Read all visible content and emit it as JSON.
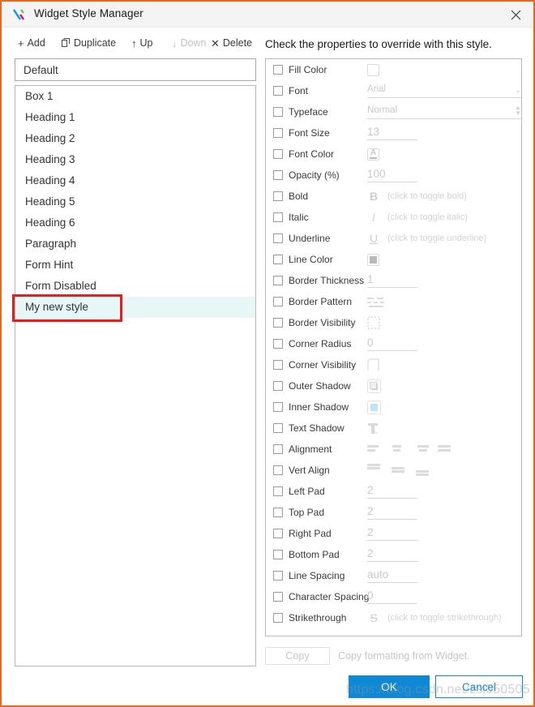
{
  "window": {
    "title": "Widget Style Manager",
    "logo_icon": "x-logo-icon",
    "close_icon": "close-icon",
    "accent_border": "#e8691c"
  },
  "toolbar": {
    "add": {
      "label": "Add",
      "glyph": "+",
      "icon": "plus-icon",
      "disabled": false
    },
    "duplicate": {
      "label": "Duplicate",
      "glyph": "❐",
      "icon": "duplicate-icon",
      "disabled": false
    },
    "up": {
      "label": "Up",
      "glyph": "↑",
      "icon": "arrow-up-icon",
      "disabled": false
    },
    "down": {
      "label": "Down",
      "glyph": "↓",
      "icon": "arrow-down-icon",
      "disabled": true
    },
    "delete": {
      "label": "Delete",
      "glyph": "✕",
      "icon": "close-x-icon",
      "disabled": false
    }
  },
  "panel_caption": "Check the properties to override with this style.",
  "style_name_field": {
    "value": "Default",
    "placeholder": "Default"
  },
  "style_list": {
    "items": [
      {
        "label": "Box 1",
        "selected": false
      },
      {
        "label": "Heading 1",
        "selected": false
      },
      {
        "label": "Heading 2",
        "selected": false
      },
      {
        "label": "Heading 3",
        "selected": false
      },
      {
        "label": "Heading 4",
        "selected": false
      },
      {
        "label": "Heading 5",
        "selected": false
      },
      {
        "label": "Heading 6",
        "selected": false
      },
      {
        "label": "Paragraph",
        "selected": false
      },
      {
        "label": "Form Hint",
        "selected": false
      },
      {
        "label": "Form Disabled",
        "selected": false
      },
      {
        "label": "My new style",
        "selected": true
      }
    ],
    "selected_highlight_color": "#e7f7f7",
    "annotation_color": "#ee1b1b"
  },
  "properties": [
    {
      "label": "Fill Color",
      "checked": false,
      "control": "swatch-empty",
      "value": ""
    },
    {
      "label": "Font",
      "checked": false,
      "control": "select",
      "value": "Arial"
    },
    {
      "label": "Typeface",
      "checked": false,
      "control": "spinner",
      "value": "Normal"
    },
    {
      "label": "Font Size",
      "checked": false,
      "control": "input",
      "value": "13"
    },
    {
      "label": "Font Color",
      "checked": false,
      "control": "font-color",
      "value": "A"
    },
    {
      "label": "Opacity (%)",
      "checked": false,
      "control": "input",
      "value": "100"
    },
    {
      "label": "Bold",
      "checked": false,
      "control": "toggle-glyph",
      "glyph": "B",
      "hint": "(click to toggle bold)"
    },
    {
      "label": "Italic",
      "checked": false,
      "control": "toggle-glyph",
      "glyph": "I",
      "hint": "(click to toggle italic)"
    },
    {
      "label": "Underline",
      "checked": false,
      "control": "toggle-glyph",
      "glyph": "U",
      "hint": "(click to toggle underline)"
    },
    {
      "label": "Line Color",
      "checked": false,
      "control": "swatch-grey",
      "value": ""
    },
    {
      "label": "Border Thickness",
      "checked": false,
      "control": "input",
      "value": "1"
    },
    {
      "label": "Border Pattern",
      "checked": false,
      "control": "dash-pattern",
      "value": ""
    },
    {
      "label": "Border Visibility",
      "checked": false,
      "control": "dotted-box",
      "value": ""
    },
    {
      "label": "Corner Radius",
      "checked": false,
      "control": "input",
      "value": "0"
    },
    {
      "label": "Corner Visibility",
      "checked": false,
      "control": "corner-shape",
      "value": ""
    },
    {
      "label": "Outer Shadow",
      "checked": false,
      "control": "outer-shadow",
      "value": ""
    },
    {
      "label": "Inner Shadow",
      "checked": false,
      "control": "inner-shadow",
      "value": ""
    },
    {
      "label": "Text Shadow",
      "checked": false,
      "control": "text-shadow",
      "value": ""
    },
    {
      "label": "Alignment",
      "checked": false,
      "control": "align-group",
      "value": ""
    },
    {
      "label": "Vert Align",
      "checked": false,
      "control": "valign-group",
      "value": ""
    },
    {
      "label": "Left Pad",
      "checked": false,
      "control": "input",
      "value": "2"
    },
    {
      "label": "Top Pad",
      "checked": false,
      "control": "input",
      "value": "2"
    },
    {
      "label": "Right Pad",
      "checked": false,
      "control": "input",
      "value": "2"
    },
    {
      "label": "Bottom Pad",
      "checked": false,
      "control": "input",
      "value": "2"
    },
    {
      "label": "Line Spacing",
      "checked": false,
      "control": "input",
      "value": "auto"
    },
    {
      "label": "Character Spacing",
      "checked": false,
      "control": "input",
      "value": "0"
    },
    {
      "label": "Strikethrough",
      "checked": false,
      "control": "toggle-glyph",
      "glyph": "S",
      "hint": "(click to toggle strikethrough)"
    }
  ],
  "footer": {
    "copy_label": "Copy",
    "copy_hint": "Copy formatting from Widget.",
    "ok_label": "OK",
    "cancel_label": "Cancel",
    "ok_color": "#0f88d6"
  },
  "watermark": "https://blog.csdn.net/zsl050505"
}
